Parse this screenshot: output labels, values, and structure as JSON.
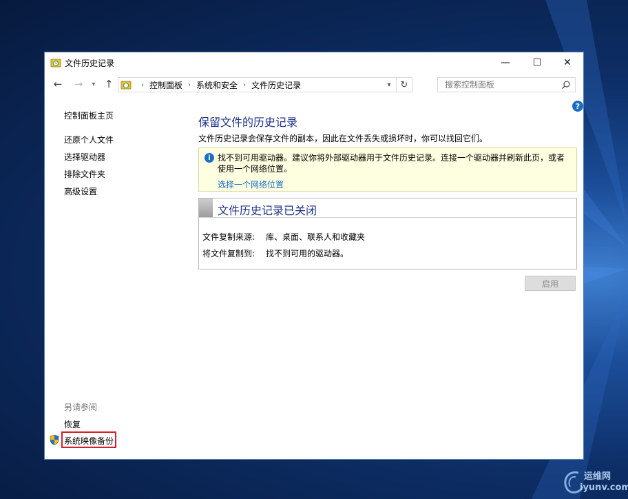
{
  "window": {
    "title": "文件历史记录",
    "controls": {
      "minimize": "—",
      "maximize": "☐",
      "close": "✕"
    }
  },
  "nav": {
    "back": "←",
    "forward": "→",
    "up": "↑",
    "breadcrumb": [
      "控制面板",
      "系统和安全",
      "文件历史记录"
    ],
    "separator": "›",
    "refresh": "↻",
    "search_placeholder": "搜索控制面板"
  },
  "sidebar": {
    "home": "控制面板主页",
    "links": [
      "还原个人文件",
      "选择驱动器",
      "排除文件夹",
      "高级设置"
    ],
    "see_also_title": "另请参阅",
    "see_also_links": [
      "恢复",
      "系统映像备份"
    ]
  },
  "main": {
    "heading": "保留文件的历史记录",
    "description": "文件历史记录会保存文件的副本，因此在文件丢失或损坏时，你可以找回它们。",
    "info": {
      "icon": "info-icon",
      "text": "找不到可用驱动器。建议你将外部驱动器用于文件历史记录。连接一个驱动器并刷新此页，或者使用一个网络位置。",
      "link": "选择一个网络位置"
    },
    "status": {
      "title": "文件历史记录已关闭",
      "rows": [
        {
          "label": "文件复制来源:",
          "value": "库、桌面、联系人和收藏夹"
        },
        {
          "label": "将文件复制到:",
          "value": "找不到可用的驱动器。"
        }
      ]
    },
    "enable_button": "启用"
  },
  "help": "?",
  "watermark": {
    "cn": "运维网",
    "en": "iyunv.com"
  },
  "colors": {
    "heading": "#1e3287",
    "link": "#1a6ec4",
    "info_bg": "#fefee1",
    "highlight": "#d4202a"
  }
}
